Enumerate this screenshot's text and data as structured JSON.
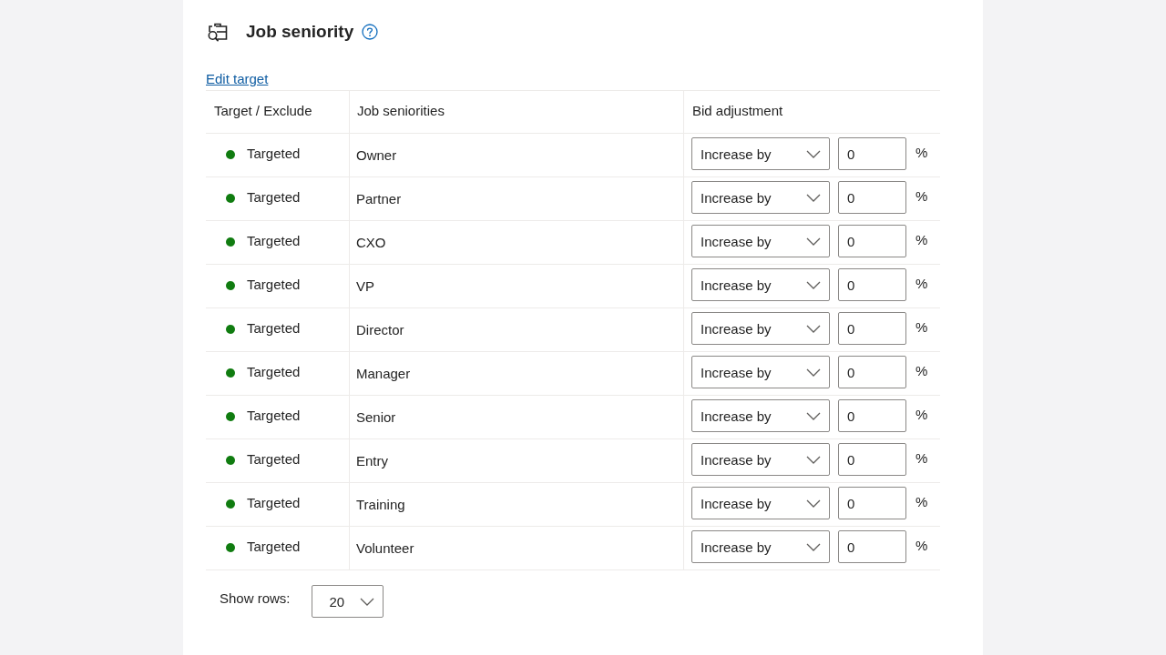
{
  "section": {
    "title": "Job seniority"
  },
  "edit_link": "Edit target",
  "table": {
    "columns": [
      "Target / Exclude",
      "Job seniorities",
      "Bid adjustment"
    ],
    "rows": [
      {
        "status": "Targeted",
        "color": "#107c10",
        "seniority": "Owner",
        "adjustment": "Increase by",
        "value": "0",
        "unit": "%"
      },
      {
        "status": "Targeted",
        "color": "#107c10",
        "seniority": "Partner",
        "adjustment": "Increase by",
        "value": "0",
        "unit": "%"
      },
      {
        "status": "Targeted",
        "color": "#107c10",
        "seniority": "CXO",
        "adjustment": "Increase by",
        "value": "0",
        "unit": "%"
      },
      {
        "status": "Targeted",
        "color": "#107c10",
        "seniority": "VP",
        "adjustment": "Increase by",
        "value": "0",
        "unit": "%"
      },
      {
        "status": "Targeted",
        "color": "#107c10",
        "seniority": "Director",
        "adjustment": "Increase by",
        "value": "0",
        "unit": "%"
      },
      {
        "status": "Targeted",
        "color": "#107c10",
        "seniority": "Manager",
        "adjustment": "Increase by",
        "value": "0",
        "unit": "%"
      },
      {
        "status": "Targeted",
        "color": "#107c10",
        "seniority": "Senior",
        "adjustment": "Increase by",
        "value": "0",
        "unit": "%"
      },
      {
        "status": "Targeted",
        "color": "#107c10",
        "seniority": "Entry",
        "adjustment": "Increase by",
        "value": "0",
        "unit": "%"
      },
      {
        "status": "Targeted",
        "color": "#107c10",
        "seniority": "Training",
        "adjustment": "Increase by",
        "value": "0",
        "unit": "%"
      },
      {
        "status": "Targeted",
        "color": "#107c10",
        "seniority": "Volunteer",
        "adjustment": "Increase by",
        "value": "0",
        "unit": "%"
      }
    ]
  },
  "show_rows": {
    "label": "Show rows:",
    "value": "20"
  }
}
